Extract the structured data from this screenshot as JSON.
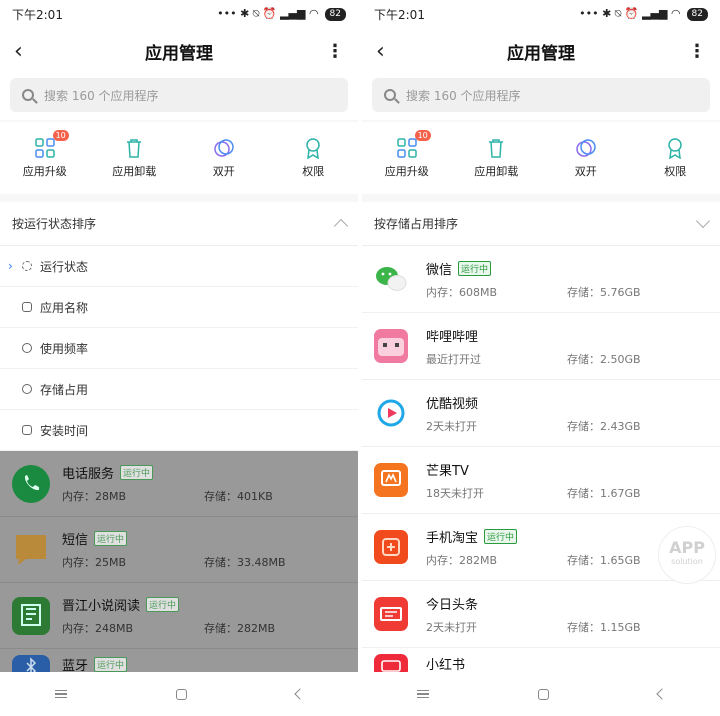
{
  "status": {
    "time": "下午2:01",
    "battery": "82"
  },
  "header": {
    "title": "应用管理",
    "back": "‹",
    "more": "⋮"
  },
  "search": {
    "placeholder": "搜索 160 个应用程序"
  },
  "actions": [
    {
      "label": "应用升级",
      "icon": "grid-update-icon",
      "badge": "10"
    },
    {
      "label": "应用卸载",
      "icon": "trash-icon"
    },
    {
      "label": "双开",
      "icon": "dual-app-icon"
    },
    {
      "label": "权限",
      "icon": "permission-badge-icon"
    }
  ],
  "left": {
    "sort_label": "按运行状态排序",
    "menu": [
      {
        "label": "运行状态",
        "icon": "running-status-icon",
        "selected": true
      },
      {
        "label": "应用名称",
        "icon": "app-name-icon"
      },
      {
        "label": "使用频率",
        "icon": "frequency-icon"
      },
      {
        "label": "存储占用",
        "icon": "storage-icon"
      },
      {
        "label": "安装时间",
        "icon": "install-time-icon"
      }
    ],
    "apps": [
      {
        "name": "电话服务",
        "tag": "运行中",
        "mem": "内存：28MB",
        "storage": "存储：401KB",
        "color": "#1a9e4a"
      },
      {
        "name": "短信",
        "tag": "",
        "tag2": "运行中",
        "mem": "内存：25MB",
        "storage": "存储：33.48MB",
        "color": "#d8a24a"
      },
      {
        "name": "晋江小说阅读",
        "tag": "运行中",
        "mem": "内存：248MB",
        "storage": "存储：282MB",
        "color": "#2c8a3a"
      },
      {
        "name": "蓝牙",
        "tag": "运行中",
        "mem": "",
        "storage": "",
        "color": "#2a6fcc"
      }
    ]
  },
  "right": {
    "sort_label": "按存储占用排序",
    "apps": [
      {
        "name": "微信",
        "tag": "运行中",
        "mem": "内存：608MB",
        "storage": "存储：5.76GB",
        "color": "#3bb54a"
      },
      {
        "name": "哔哩哔哩",
        "tag": "",
        "mem": "最近打开过",
        "storage": "存储：2.50GB",
        "color": "#f07aa0"
      },
      {
        "name": "优酷视频",
        "tag": "",
        "mem": "2天未打开",
        "storage": "存储：2.43GB",
        "color": "#ffffff"
      },
      {
        "name": "芒果TV",
        "tag": "",
        "mem": "18天未打开",
        "storage": "存储：1.67GB",
        "color": "#f5741f"
      },
      {
        "name": "手机淘宝",
        "tag": "运行中",
        "mem": "内存：282MB",
        "storage": "存储：1.65GB",
        "color": "#f04a1d"
      },
      {
        "name": "今日头条",
        "tag": "",
        "mem": "2天未打开",
        "storage": "存储：1.15GB",
        "color": "#ef3b33"
      },
      {
        "name": "小红书",
        "tag": "",
        "mem": "",
        "storage": "",
        "color": "#ee2a3b"
      }
    ]
  },
  "watermark": {
    "line1": "APP",
    "line2": "solution"
  },
  "colors": {
    "accent": "#2f7ff0",
    "running": "#2a9a3f",
    "badge": "#f5624c",
    "icon_teal": "#2bb3a8"
  }
}
